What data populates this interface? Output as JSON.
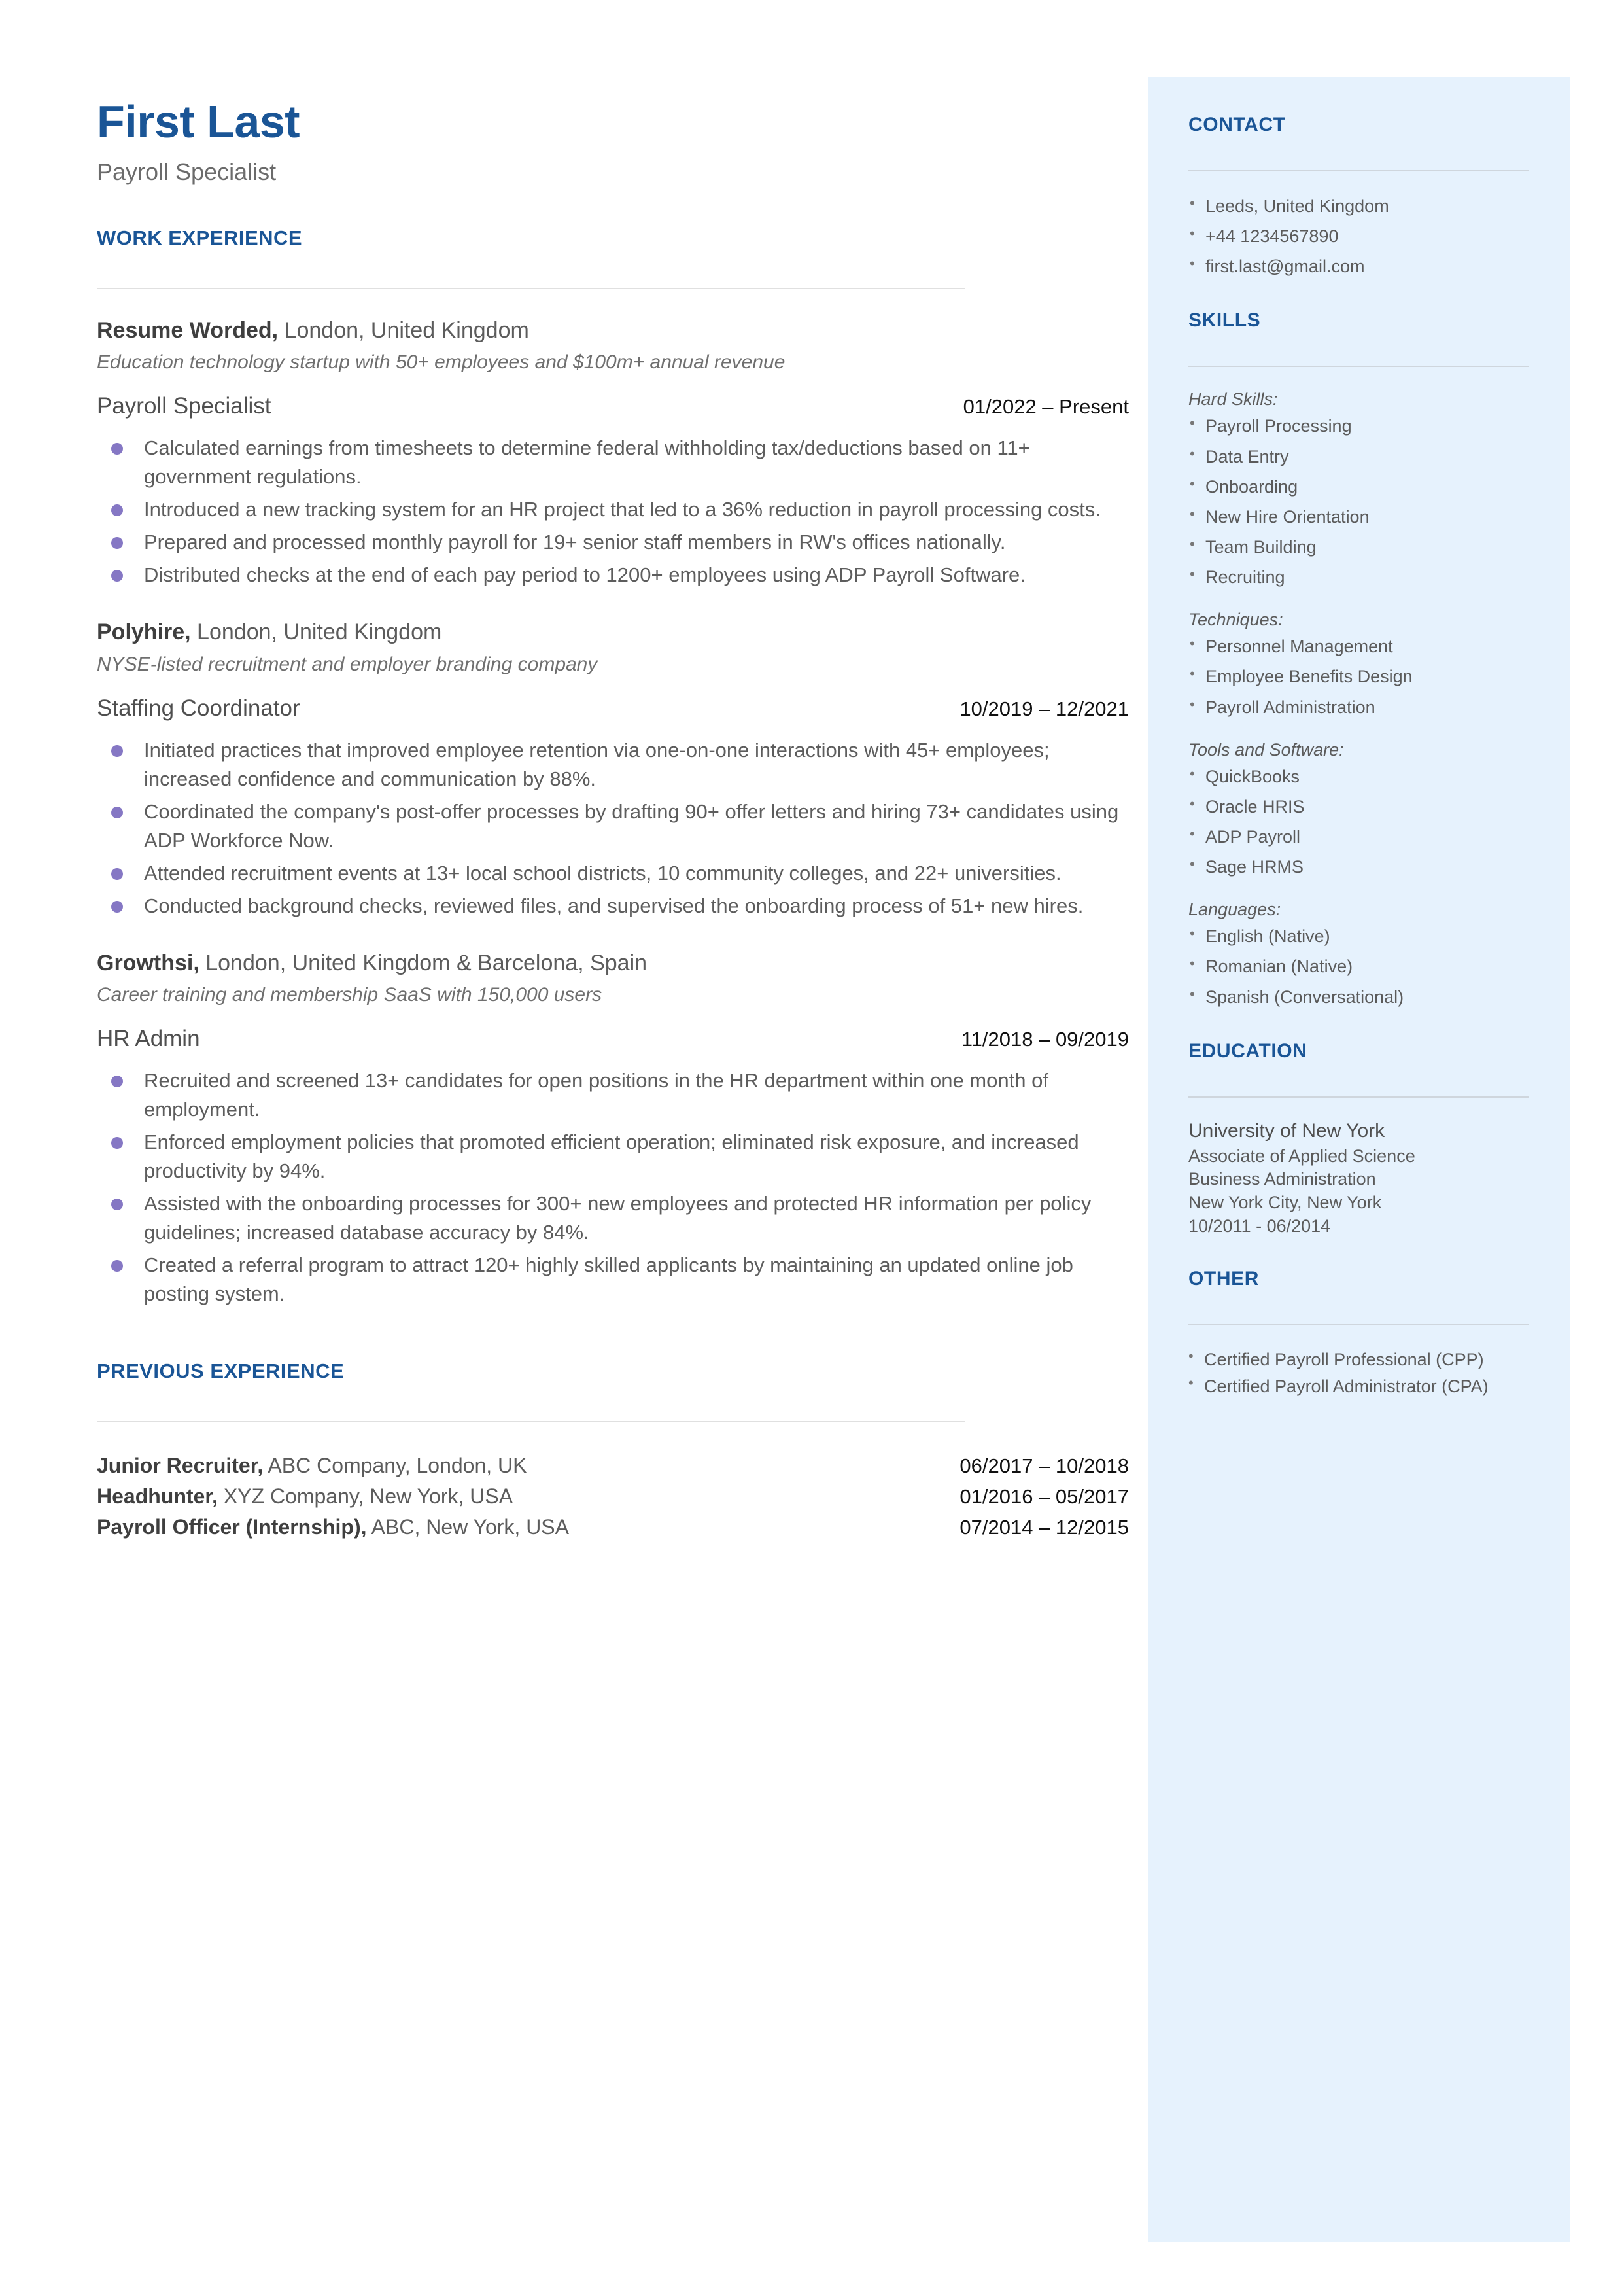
{
  "header": {
    "name": "First Last",
    "tagline": "Payroll Specialist"
  },
  "main": {
    "work_experience_heading": "WORK EXPERIENCE",
    "previous_experience_heading": "PREVIOUS EXPERIENCE",
    "jobs": [
      {
        "company": "Resume Worded,",
        "location": " London, United Kingdom",
        "description": "Education technology startup with 50+ employees and $100m+ annual revenue",
        "title": "Payroll Specialist",
        "dates": "01/2022 – Present",
        "bullets": [
          "Calculated earnings from timesheets to determine federal withholding tax/deductions based on 11+ government regulations.",
          "Introduced a new tracking system for an HR project that led to a 36% reduction in payroll processing costs.",
          "Prepared and processed monthly payroll for 19+ senior staff members in RW's offices nationally.",
          "Distributed checks at the end of each pay period to 1200+ employees using ADP Payroll Software."
        ]
      },
      {
        "company": "Polyhire,",
        "location": " London, United Kingdom",
        "description": "NYSE-listed recruitment and employer branding company",
        "title": "Staffing Coordinator",
        "dates": "10/2019 – 12/2021",
        "bullets": [
          "Initiated practices that improved employee retention via one-on-one interactions with 45+ employees; increased confidence and communication by 88%.",
          "Coordinated the company's post-offer processes by drafting 90+ offer letters and hiring 73+ candidates using ADP Workforce Now.",
          "Attended recruitment events at 13+ local school districts, 10 community colleges, and 22+ universities.",
          "Conducted background checks, reviewed files, and supervised the onboarding process of 51+ new hires."
        ]
      },
      {
        "company": "Growthsi,",
        "location": " London, United Kingdom & Barcelona, Spain",
        "description": "Career training and membership SaaS with 150,000 users",
        "title": "HR Admin",
        "dates": "11/2018 – 09/2019",
        "bullets": [
          "Recruited and screened 13+ candidates for open positions in the HR department within one month of employment.",
          "Enforced employment policies that promoted efficient operation; eliminated risk exposure, and increased productivity by 94%.",
          "Assisted with the onboarding processes for 300+ new employees and protected HR information per policy guidelines; increased database accuracy by 84%.",
          "Created a referral program to attract 120+ highly skilled applicants by maintaining an updated online job posting system."
        ]
      }
    ],
    "previous_experience": [
      {
        "role": "Junior Recruiter,",
        "detail": " ABC Company, London, UK",
        "dates": "06/2017 – 10/2018"
      },
      {
        "role": "Headhunter,",
        "detail": " XYZ Company, New York, USA",
        "dates": "01/2016 – 05/2017"
      },
      {
        "role": "Payroll Officer (Internship),",
        "detail": " ABC, New York, USA",
        "dates": "07/2014 – 12/2015"
      }
    ]
  },
  "sidebar": {
    "contact": {
      "heading": "CONTACT",
      "items": [
        "Leeds, United Kingdom",
        "+44 1234567890",
        "first.last@gmail.com"
      ]
    },
    "skills": {
      "heading": "SKILLS",
      "groups": [
        {
          "label": "Hard Skills:",
          "items": [
            "Payroll Processing",
            "Data Entry",
            "Onboarding",
            "New Hire Orientation",
            "Team Building",
            "Recruiting"
          ]
        },
        {
          "label": "Techniques:",
          "items": [
            "Personnel Management",
            "Employee Benefits Design",
            "Payroll Administration"
          ]
        },
        {
          "label": "Tools and Software:",
          "items": [
            "QuickBooks",
            "Oracle HRIS",
            "ADP Payroll",
            "Sage HRMS"
          ]
        },
        {
          "label": "Languages:",
          "items": [
            "English (Native)",
            "Romanian (Native)",
            "Spanish (Conversational)"
          ]
        }
      ]
    },
    "education": {
      "heading": "EDUCATION",
      "school": "University of New York",
      "degree": "Associate of Applied Science",
      "field": "Business Administration",
      "location": "New York City, New York",
      "dates": "10/2011 - 06/2014"
    },
    "other": {
      "heading": "OTHER",
      "items": [
        "Certified Payroll Professional (CPP)",
        "Certified Payroll Administrator (CPA)"
      ]
    }
  },
  "colors": {
    "accent_blue": "#1a5596",
    "sidebar_bg": "#e6f2fd",
    "bullet_purple": "#8577c4",
    "body_gray": "#5d5d5d"
  }
}
